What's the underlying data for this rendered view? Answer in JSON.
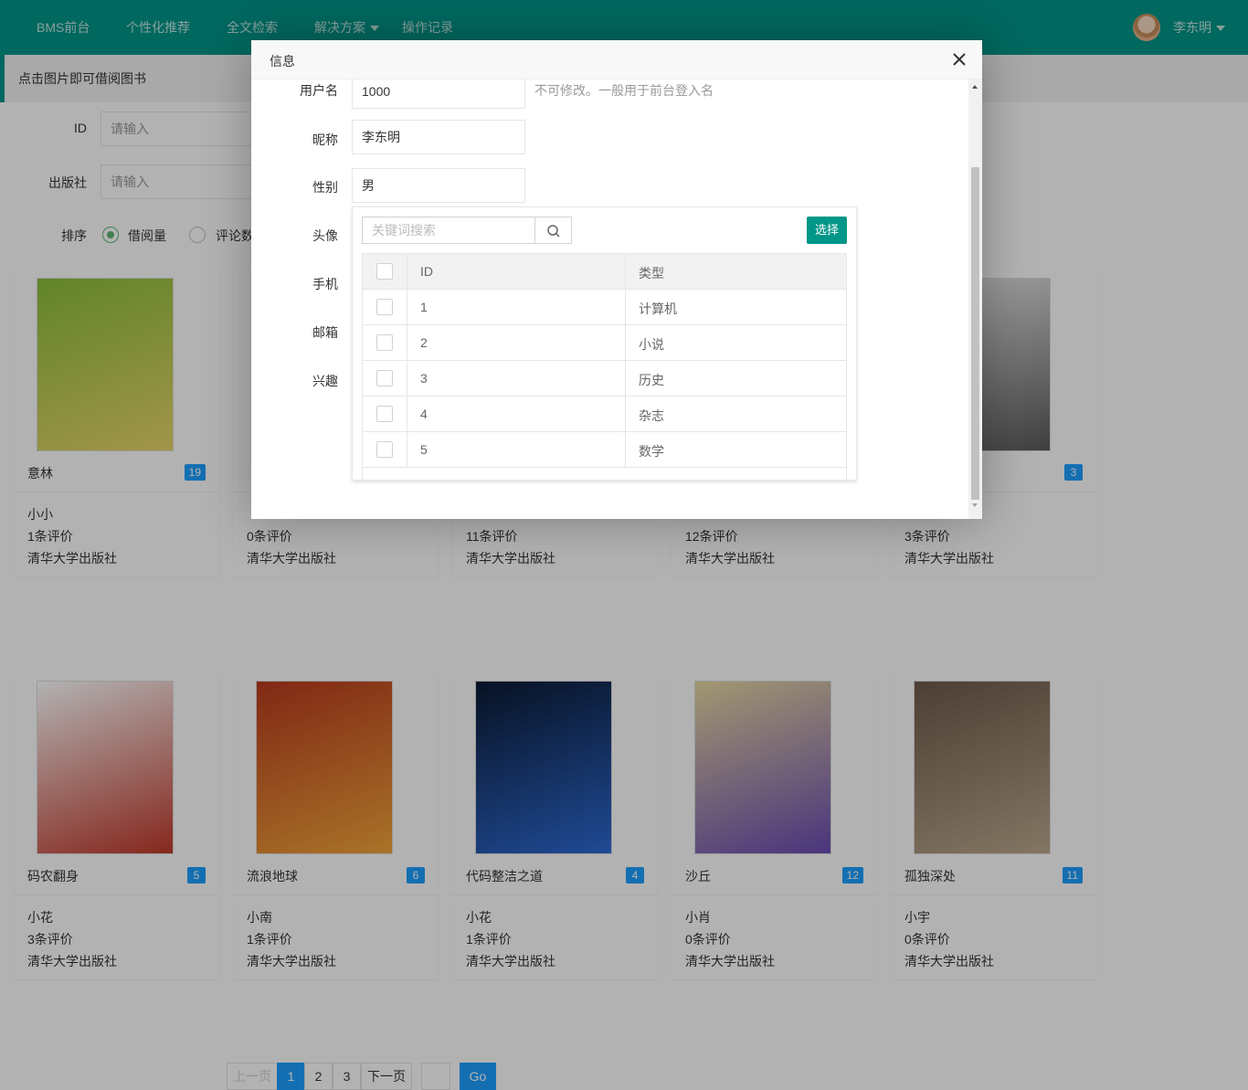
{
  "header": {
    "brand": "BMS前台",
    "nav": [
      "个性化推荐",
      "全文检索",
      "解决方案",
      "操作记录"
    ],
    "user_name": "李东明"
  },
  "notice": "点击图片即可借阅图书",
  "search": {
    "id_label": "ID",
    "publisher_label": "出版社",
    "placeholder": "请输入",
    "sort_label": "排序",
    "sort_options": [
      "借阅量",
      "评论数"
    ]
  },
  "books": [
    {
      "title": "意林",
      "badge": "19",
      "author": "小小",
      "reviews": "1条评价",
      "publisher": "清华大学出版社"
    },
    {
      "title": "",
      "badge": "",
      "author": "",
      "reviews": "0条评价",
      "publisher": "清华大学出版社"
    },
    {
      "title": "",
      "badge": "",
      "author": "",
      "reviews": "11条评价",
      "publisher": "清华大学出版社"
    },
    {
      "title": "",
      "badge": "",
      "author": "",
      "reviews": "12条评价",
      "publisher": "清华大学出版社"
    },
    {
      "title": "",
      "badge": "3",
      "author": "",
      "reviews": "3条评价",
      "publisher": "清华大学出版社"
    },
    {
      "title": "码农翻身",
      "badge": "5",
      "author": "小花",
      "reviews": "3条评价",
      "publisher": "清华大学出版社"
    },
    {
      "title": "流浪地球",
      "badge": "6",
      "author": "小南",
      "reviews": "1条评价",
      "publisher": "清华大学出版社"
    },
    {
      "title": "代码整洁之道",
      "badge": "4",
      "author": "小花",
      "reviews": "1条评价",
      "publisher": "清华大学出版社"
    },
    {
      "title": "沙丘",
      "badge": "12",
      "author": "小肖",
      "reviews": "0条评价",
      "publisher": "清华大学出版社"
    },
    {
      "title": "孤独深处",
      "badge": "11",
      "author": "小宇",
      "reviews": "0条评价",
      "publisher": "清华大学出版社"
    }
  ],
  "pagination": {
    "prev": "上一页",
    "pages": [
      "1",
      "2",
      "3"
    ],
    "next": "下一页",
    "go": "Go"
  },
  "modal": {
    "title": "信息",
    "fields": {
      "username_label": "用户名",
      "username_value": "1000",
      "username_hint": "不可修改。一般用于前台登入名",
      "nickname_label": "昵称",
      "nickname_value": "李东明",
      "gender_label": "性别",
      "gender_value": "男",
      "avatar_label": "头像",
      "phone_label": "手机",
      "email_label": "邮箱",
      "interest_label": "兴趣"
    },
    "table_select": {
      "search_placeholder": "关键词搜索",
      "select_button": "选择",
      "columns": [
        "ID",
        "类型"
      ],
      "rows": [
        {
          "id": "1",
          "type": "计算机"
        },
        {
          "id": "2",
          "type": "小说"
        },
        {
          "id": "3",
          "type": "历史"
        },
        {
          "id": "4",
          "type": "杂志"
        },
        {
          "id": "5",
          "type": "数学"
        }
      ]
    }
  },
  "colors": {
    "primary": "#009688",
    "badge": "#1e9fff",
    "radio_on": "#5fb878"
  }
}
